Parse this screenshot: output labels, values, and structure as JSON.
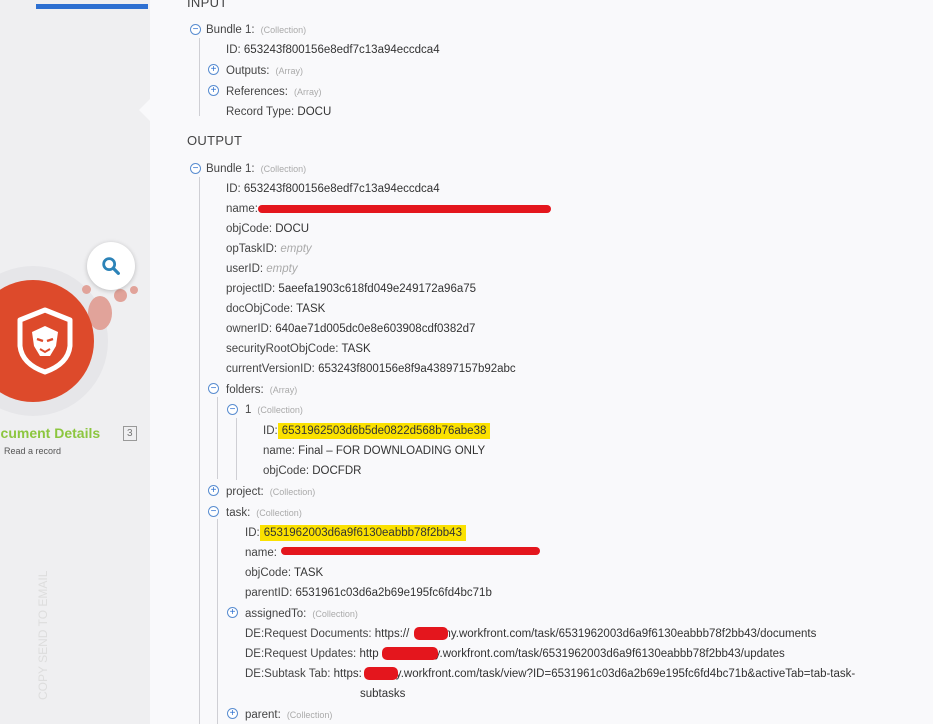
{
  "left": {
    "module_title": "ocument Details",
    "module_badge": "3",
    "module_subtitle": "Read a record",
    "watermark": "COPY SEND TO EMAIL"
  },
  "input": {
    "heading": "INPUT",
    "bundle": "Bundle 1:",
    "bundle_type": "(Collection)",
    "id_key": "ID:",
    "id_value": "653243f800156e8edf7c13a94eccdca4",
    "outputs_key": "Outputs:",
    "outputs_type": "(Array)",
    "references_key": "References:",
    "references_type": "(Array)",
    "record_type_key": "Record Type:",
    "record_type_value": "DOCU"
  },
  "output": {
    "heading": "OUTPUT",
    "bundle": "Bundle 1:",
    "bundle_type": "(Collection)",
    "id_key": "ID:",
    "id_value": "653243f800156e8edf7c13a94eccdca4",
    "name_key": "name:",
    "objcode_key": "objCode:",
    "objcode_value": "DOCU",
    "optaskid_key": "opTaskID:",
    "optaskid_value": "empty",
    "userid_key": "userID:",
    "userid_value": "empty",
    "projectid_key": "projectID:",
    "projectid_value": "5aeefa1903c618fd049e249172a96a75",
    "docobjcode_key": "docObjCode:",
    "docobjcode_value": "TASK",
    "ownerid_key": "ownerID:",
    "ownerid_value": "640ae71d005dc0e8e603908cdf0382d7",
    "securityroot_key": "securityRootObjCode:",
    "securityroot_value": "TASK",
    "currentversion_key": "currentVersionID:",
    "currentversion_value": "653243f800156e8f9a43897157b92abc",
    "folders_key": "folders:",
    "folders_type": "(Array)",
    "folder1_key": "1",
    "folder1_type": "(Collection)",
    "folder_id_key": "ID:",
    "folder_id_value": "6531962503d6b5de0822d568b76abe38",
    "folder_name_key": "name:",
    "folder_name_value": "Final – FOR DOWNLOADING ONLY",
    "folder_objcode_key": "objCode:",
    "folder_objcode_value": "DOCFDR",
    "project_key": "project:",
    "project_type": "(Collection)",
    "task_key": "task:",
    "task_type": "(Collection)",
    "task_id_key": "ID:",
    "task_id_value": "6531962003d6a9f6130eabbb78f2bb43",
    "task_name_key": "name:",
    "task_objcode_key": "objCode:",
    "task_objcode_value": "TASK",
    "task_parentid_key": "parentID:",
    "task_parentid_value": "6531961c03d6a2b69e195fc6fd4bc71b",
    "assignedto_key": "assignedTo:",
    "assignedto_type": "(Collection)",
    "req_docs_key": "DE:Request Documents:",
    "req_docs_prefix": "https://",
    "req_docs_suffix": "my.workfront.com/task/6531962003d6a9f6130eabbb78f2bb43/documents",
    "req_updates_key": "DE:Request Updates:",
    "req_updates_prefix": "http",
    "req_updates_suffix": "y.workfront.com/task/6531962003d6a9f6130eabbb78f2bb43/updates",
    "subtask_key": "DE:Subtask Tab:",
    "subtask_prefix": "https:",
    "subtask_suffix": "y.workfront.com/task/view?ID=6531961c03d6a2b69e195fc6fd4bc71b&activeTab=tab-task-",
    "subtask_line2": "subtasks",
    "parent_key": "parent:",
    "parent_type": "(Collection)"
  },
  "colors": {
    "highlight": "#fbe100",
    "redaction": "#e4161d",
    "module": "#dd4a2b",
    "module_title": "#8cc63f",
    "toggle": "#2b6fd0"
  },
  "icons": [
    "search-icon",
    "lion-logo-icon",
    "collapse-icon",
    "expand-icon"
  ]
}
